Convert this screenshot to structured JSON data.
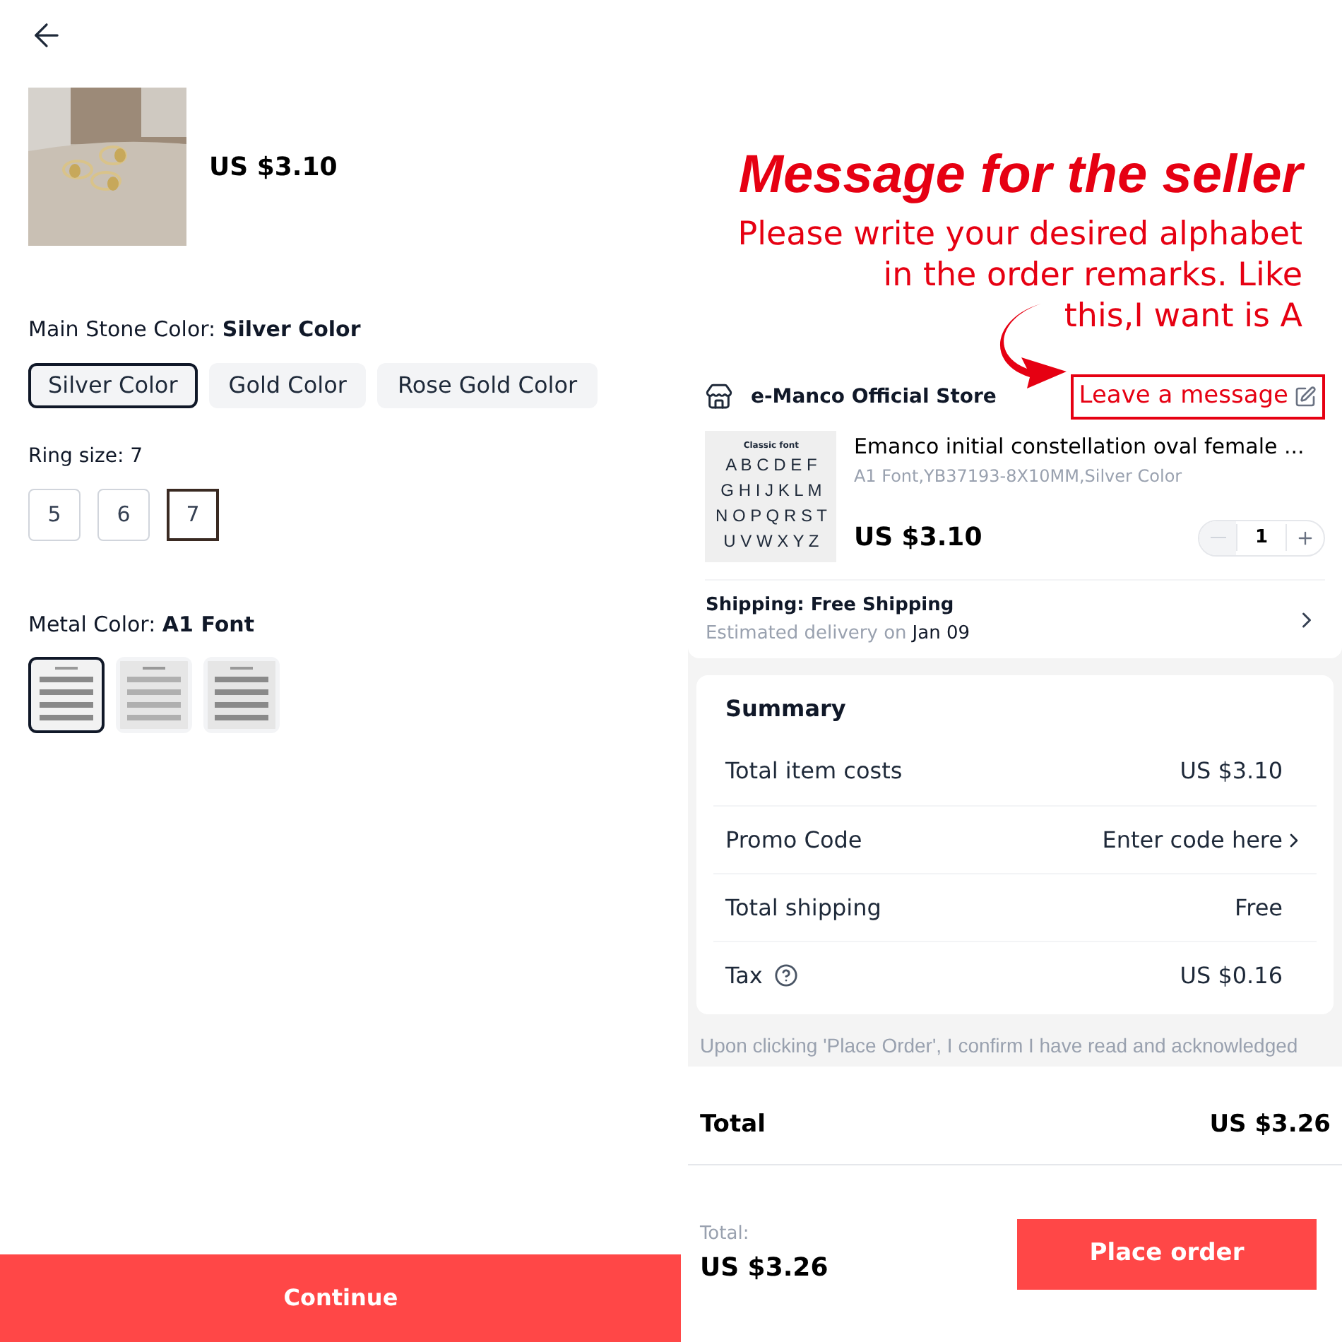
{
  "left": {
    "product": {
      "image": {
        "kind": "picture"
      },
      "price": "US $3.10"
    },
    "stone_color": {
      "label": "Main Stone Color:",
      "value": "Silver Color",
      "options": [
        {
          "label": "Silver Color",
          "selected": true
        },
        {
          "label": "Gold Color",
          "selected": false
        },
        {
          "label": "Rose Gold Color",
          "selected": false
        }
      ]
    },
    "ring_size": {
      "label": "Ring size:",
      "value": "7",
      "options": [
        {
          "label": "5",
          "selected": false
        },
        {
          "label": "6",
          "selected": false
        },
        {
          "label": "7",
          "selected": true
        }
      ]
    },
    "metal_color": {
      "label": "Metal Color:",
      "value": "A1 Font",
      "options": [
        {
          "kind": "picture",
          "selected": true
        },
        {
          "kind": "picture",
          "selected": false
        },
        {
          "kind": "picture",
          "selected": false
        }
      ]
    },
    "continue_button": "Continue"
  },
  "right": {
    "heading": "Message for the seller",
    "note_lines": [
      "Please write your desired alphabet",
      "in the order remarks. Like",
      "this,I want is A"
    ],
    "store": {
      "name": "e-Manco Official Store",
      "leave_message": "Leave a message"
    },
    "item": {
      "thumbnail": {
        "caption": "Classic font",
        "rows": [
          "A B C D E F",
          "G H I J K L M",
          "N O P Q R S T",
          "U V W X Y Z"
        ]
      },
      "title": "Emanco initial constellation oval female  ...",
      "variant": "A1 Font,YB37193-8X10MM,Silver Color",
      "price": "US $3.10",
      "quantity": "1",
      "decrease_disabled": true
    },
    "shipping": {
      "title": "Shipping: Free Shipping",
      "estimate": "Estimated delivery on",
      "date": "Jan 09"
    },
    "summary": {
      "title": "Summary",
      "rows": [
        {
          "kind": "plain",
          "label": "Total item costs",
          "value": "US $3.10"
        },
        {
          "kind": "link",
          "label": "Promo Code",
          "value": "Enter code here"
        },
        {
          "kind": "plain",
          "label": "Total shipping",
          "value": "Free"
        },
        {
          "kind": "help",
          "label": "Tax",
          "value": "US $0.16"
        }
      ]
    },
    "disclaimer": "Upon clicking 'Place Order', I confirm I have read and acknowledged",
    "total": {
      "label": "Total",
      "value": "US $3.26"
    },
    "footer": {
      "label": "Total:",
      "value": "US $3.26",
      "button": "Place order"
    }
  }
}
